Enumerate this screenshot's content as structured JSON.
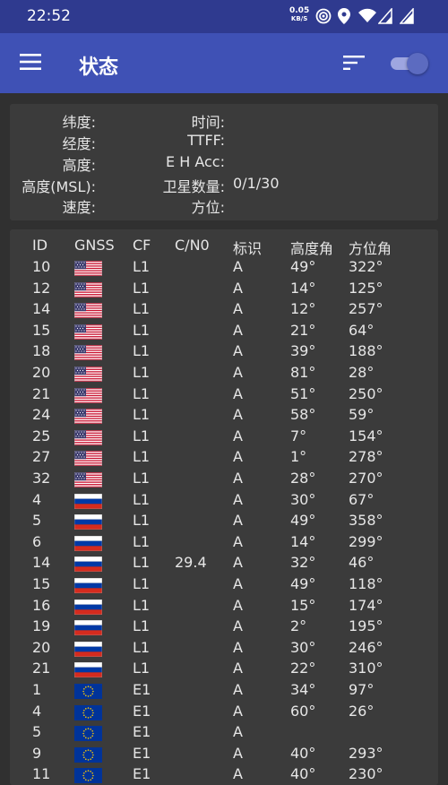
{
  "status_bar": {
    "time": "22:52",
    "net_speed_value": "0.05",
    "net_speed_unit": "KB/S",
    "icons": [
      "hotspot-icon",
      "location-icon",
      "wifi-icon",
      "signal-icon",
      "signal-icon-2"
    ]
  },
  "app_bar": {
    "title": "状态",
    "menu_icon": "menu-icon",
    "sort_icon": "sort-icon",
    "toggle_on": true
  },
  "info": {
    "latitude_label": "纬度:",
    "longitude_label": "经度:",
    "altitude_label": "高度:",
    "altitude_msl_label": "高度(MSL):",
    "speed_label": "速度:",
    "time_label": "时间:",
    "ttff_label": "TTFF:",
    "eh_acc_label": "E H Acc:",
    "sat_count_label": "卫星数量:",
    "sat_count_value": "0/1/30",
    "bearing_label": "方位:"
  },
  "table": {
    "headers": {
      "id": "ID",
      "gnss": "GNSS",
      "cf": "CF",
      "cn0": "C/N0",
      "flags": "标识",
      "elevation": "高度角",
      "azimuth": "方位角"
    },
    "rows": [
      {
        "id": "10",
        "gnss": "us",
        "cf": "L1",
        "cn0": "",
        "flags": "A",
        "el": "49°",
        "az": "322°"
      },
      {
        "id": "12",
        "gnss": "us",
        "cf": "L1",
        "cn0": "",
        "flags": "A",
        "el": "14°",
        "az": "125°"
      },
      {
        "id": "14",
        "gnss": "us",
        "cf": "L1",
        "cn0": "",
        "flags": "A",
        "el": "12°",
        "az": "257°"
      },
      {
        "id": "15",
        "gnss": "us",
        "cf": "L1",
        "cn0": "",
        "flags": "A",
        "el": "21°",
        "az": "64°"
      },
      {
        "id": "18",
        "gnss": "us",
        "cf": "L1",
        "cn0": "",
        "flags": "A",
        "el": "39°",
        "az": "188°"
      },
      {
        "id": "20",
        "gnss": "us",
        "cf": "L1",
        "cn0": "",
        "flags": "A",
        "el": "81°",
        "az": "28°"
      },
      {
        "id": "21",
        "gnss": "us",
        "cf": "L1",
        "cn0": "",
        "flags": "A",
        "el": "51°",
        "az": "250°"
      },
      {
        "id": "24",
        "gnss": "us",
        "cf": "L1",
        "cn0": "",
        "flags": "A",
        "el": "58°",
        "az": "59°"
      },
      {
        "id": "25",
        "gnss": "us",
        "cf": "L1",
        "cn0": "",
        "flags": "A",
        "el": "7°",
        "az": "154°"
      },
      {
        "id": "27",
        "gnss": "us",
        "cf": "L1",
        "cn0": "",
        "flags": "A",
        "el": "1°",
        "az": "278°"
      },
      {
        "id": "32",
        "gnss": "us",
        "cf": "L1",
        "cn0": "",
        "flags": "A",
        "el": "28°",
        "az": "270°"
      },
      {
        "id": "4",
        "gnss": "ru",
        "cf": "L1",
        "cn0": "",
        "flags": "A",
        "el": "30°",
        "az": "67°"
      },
      {
        "id": "5",
        "gnss": "ru",
        "cf": "L1",
        "cn0": "",
        "flags": "A",
        "el": "49°",
        "az": "358°"
      },
      {
        "id": "6",
        "gnss": "ru",
        "cf": "L1",
        "cn0": "",
        "flags": "A",
        "el": "14°",
        "az": "299°"
      },
      {
        "id": "14",
        "gnss": "ru",
        "cf": "L1",
        "cn0": "29.4",
        "flags": "A",
        "el": "32°",
        "az": "46°"
      },
      {
        "id": "15",
        "gnss": "ru",
        "cf": "L1",
        "cn0": "",
        "flags": "A",
        "el": "49°",
        "az": "118°"
      },
      {
        "id": "16",
        "gnss": "ru",
        "cf": "L1",
        "cn0": "",
        "flags": "A",
        "el": "15°",
        "az": "174°"
      },
      {
        "id": "19",
        "gnss": "ru",
        "cf": "L1",
        "cn0": "",
        "flags": "A",
        "el": "2°",
        "az": "195°"
      },
      {
        "id": "20",
        "gnss": "ru",
        "cf": "L1",
        "cn0": "",
        "flags": "A",
        "el": "30°",
        "az": "246°"
      },
      {
        "id": "21",
        "gnss": "ru",
        "cf": "L1",
        "cn0": "",
        "flags": "A",
        "el": "22°",
        "az": "310°"
      },
      {
        "id": "1",
        "gnss": "eu",
        "cf": "E1",
        "cn0": "",
        "flags": "A",
        "el": "34°",
        "az": "97°"
      },
      {
        "id": "4",
        "gnss": "eu",
        "cf": "E1",
        "cn0": "",
        "flags": "A",
        "el": "60°",
        "az": "26°"
      },
      {
        "id": "5",
        "gnss": "eu",
        "cf": "E1",
        "cn0": "",
        "flags": "A",
        "el": "",
        "az": ""
      },
      {
        "id": "9",
        "gnss": "eu",
        "cf": "E1",
        "cn0": "",
        "flags": "A",
        "el": "40°",
        "az": "293°"
      },
      {
        "id": "11",
        "gnss": "eu",
        "cf": "E1",
        "cn0": "",
        "flags": "A",
        "el": "40°",
        "az": "230°"
      }
    ]
  },
  "flag_icons": {
    "us": "us-flag-icon",
    "ru": "russia-flag-icon",
    "eu": "eu-flag-icon"
  },
  "colors": {
    "status_bar": "#2f3a8f",
    "app_bar": "#3f51b5",
    "background": "#303030",
    "card": "#3b3b3b",
    "toggle_knob": "#5c6bc0"
  }
}
